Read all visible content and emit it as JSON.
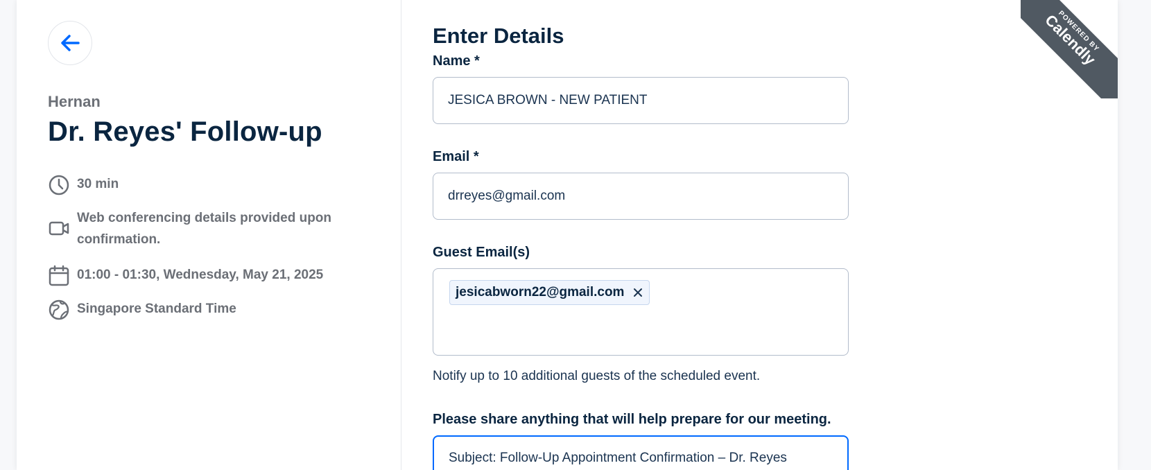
{
  "left": {
    "host": "Hernan",
    "title": "Dr. Reyes' Follow-up",
    "duration": "30 min",
    "conferencing": "Web conferencing details provided upon confirmation.",
    "datetime": "01:00 - 01:30, Wednesday, May 21, 2025",
    "timezone": "Singapore Standard Time"
  },
  "form": {
    "heading": "Enter Details",
    "name_label": "Name *",
    "name_value": "JESICA BROWN - NEW PATIENT",
    "email_label": "Email *",
    "email_value": "drreyes@gmail.com",
    "guest_label": "Guest Email(s)",
    "guest_chip": "jesicabworn22@gmail.com",
    "guest_hint": "Notify up to 10 additional guests of the scheduled event.",
    "share_label": "Please share anything that will help prepare for our meeting.",
    "share_value": "Subject: Follow-Up Appointment Confirmation – Dr. Reyes"
  },
  "badge": {
    "powered": "POWERED BY",
    "brand": "Calendly"
  },
  "colors": {
    "accent": "#0069ff",
    "ribbon": "#505962",
    "heading": "#0a2540"
  }
}
